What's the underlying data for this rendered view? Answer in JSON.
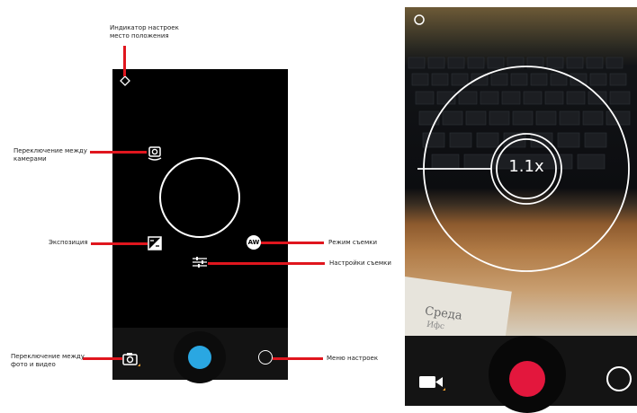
{
  "annotations": {
    "location_indicator": "Индикатор настроек\nместо положения",
    "switch_camera": "Переключение между\nкамерами",
    "exposure": "Экспозиция",
    "shooting_mode": "Режим съемки",
    "shooting_settings": "Настройки съемки",
    "switch_photo_video": "Переключение между\nфото и видео",
    "settings_menu": "Меню настроек"
  },
  "left_screen": {
    "mode_badge": "AW"
  },
  "right_screen": {
    "zoom_level": "1.1x",
    "paper_text_1": "Среда",
    "paper_text_2": "Ифс"
  },
  "colors": {
    "annotation_line": "#e0161e",
    "photo_shutter": "#2aa7e2",
    "video_record": "#e3173d"
  }
}
